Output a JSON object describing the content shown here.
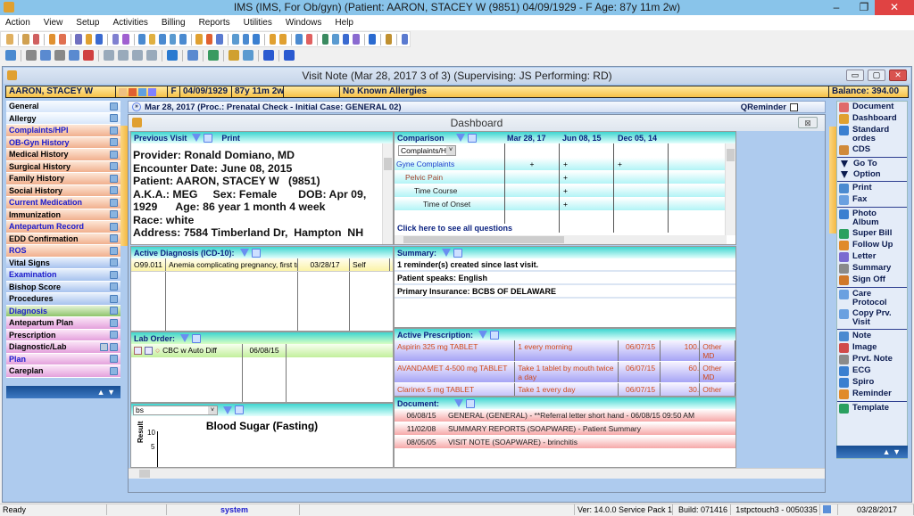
{
  "window": {
    "title": "IMS (IMS, For Ob/gyn)    (Patient: AARON, STACEY W (9851) 04/09/1929 - F Age: 87y 11m 2w)",
    "controls": [
      "minimize",
      "restore",
      "close"
    ]
  },
  "menu": [
    "Action",
    "View",
    "Setup",
    "Activities",
    "Billing",
    "Reports",
    "Utilities",
    "Windows",
    "Help"
  ],
  "visit_note": {
    "title": "Visit Note (Mar 28, 2017   3 of 3) (Supervising: JS Performing: RD)",
    "patient_bar": {
      "name": "AARON, STACEY W",
      "sex": "F",
      "dob": "04/09/1929",
      "age": "87y 11m 2w",
      "blank": "",
      "allergies": "No Known Allergies",
      "balance": "Balance: 394.00"
    },
    "visit_header": "Mar 28, 2017  (Proc.: Prenatal Check - Initial  Case: GENERAL 02)",
    "qreminder_label": "QReminder"
  },
  "sidebar": {
    "items": [
      {
        "label": "General",
        "style": "blue",
        "highlight": false
      },
      {
        "label": "Allergy",
        "style": "blue",
        "highlight": false
      },
      {
        "label": "Complaints/HPI",
        "style": "orange",
        "highlight": true
      },
      {
        "label": "OB-Gyn History",
        "style": "orange",
        "highlight": true
      },
      {
        "label": "Medical History",
        "style": "orange",
        "highlight": false
      },
      {
        "label": "Surgical History",
        "style": "orange",
        "highlight": false
      },
      {
        "label": "Family History",
        "style": "orange",
        "highlight": false
      },
      {
        "label": "Social History",
        "style": "orange",
        "highlight": false
      },
      {
        "label": "Current Medication",
        "style": "orange",
        "highlight": true
      },
      {
        "label": "Immunization",
        "style": "orange",
        "highlight": false
      },
      {
        "label": "Antepartum Record",
        "style": "orange",
        "highlight": true
      },
      {
        "label": "EDD Confirmation",
        "style": "orange",
        "highlight": false
      },
      {
        "label": "ROS",
        "style": "orange",
        "highlight": true
      },
      {
        "label": "Vital Signs",
        "style": "lblue",
        "highlight": false
      },
      {
        "label": "Examination",
        "style": "lblue",
        "highlight": true
      },
      {
        "label": "Bishop Score",
        "style": "lblue",
        "highlight": false
      },
      {
        "label": "Procedures",
        "style": "lblue",
        "highlight": false
      },
      {
        "label": "Diagnosis",
        "style": "green",
        "highlight": true
      },
      {
        "label": "Antepartum Plan",
        "style": "pink",
        "highlight": false
      },
      {
        "label": "Prescription",
        "style": "pink",
        "highlight": false
      },
      {
        "label": "Diagnostic/Lab",
        "style": "pink",
        "highlight": false
      },
      {
        "label": "Plan",
        "style": "pink",
        "highlight": true
      },
      {
        "label": "Careplan",
        "style": "pink",
        "highlight": false
      }
    ],
    "nav": "▲ ▼"
  },
  "dashboard": {
    "title": "Dashboard",
    "close": "⊠",
    "previous_visit": {
      "label": "Previous Visit",
      "print": "Print",
      "lines": [
        "Provider: Ronald Domiano, MD",
        "Encounter Date: June 08, 2015",
        "Patient: AARON, STACEY W   (9851)",
        "A.K.A.: MEG     Sex: Female       DOB: Apr 09,",
        "1929      Age: 86 year 1 month 4 week",
        "Race: white",
        "Address: 7584 Timberland Dr,  Hampton  NH"
      ]
    },
    "comparison": {
      "label": "Comparison",
      "dates": [
        "Mar 28, 17",
        "Jun 08, 15",
        "Dec 05, 14"
      ],
      "select_value": "Complaints/HPI",
      "rows": [
        {
          "label": "Gyne Complaints",
          "marks": [
            "+",
            "+",
            "+"
          ],
          "color": "#1a3ccc",
          "indent": 0
        },
        {
          "label": "Pelvic Pain",
          "marks": [
            "",
            "+",
            ""
          ],
          "color": "#a0402a",
          "indent": 1
        },
        {
          "label": "Time Course",
          "marks": [
            "",
            "+",
            ""
          ],
          "color": "#222",
          "indent": 2
        },
        {
          "label": "Time of Onset",
          "marks": [
            "",
            "+",
            ""
          ],
          "color": "#222",
          "indent": 3
        }
      ],
      "link": "Click here to see all questions"
    },
    "active_diagnosis": {
      "label": "Active Diagnosis (ICD-10):",
      "rows": [
        {
          "code": "O99.011",
          "desc": "Anemia complicating pregnancy, first trim",
          "date": "03/28/17",
          "by": "Self"
        }
      ]
    },
    "summary": {
      "label": "Summary:",
      "lines": [
        "1 reminder(s) created since last visit.",
        "Patient speaks: English",
        "Primary Insurance: BCBS OF DELAWARE"
      ]
    },
    "lab_order": {
      "label": "Lab Order:",
      "rows": [
        {
          "test": "CBC w Auto Diff",
          "date": "06/08/15"
        }
      ]
    },
    "active_prescription": {
      "label": "Active Prescription:",
      "rows": [
        {
          "drug": "Aspirin 325 mg TABLET",
          "sig": "1 every morning",
          "date": "06/07/15",
          "qty": "100.",
          "by": "Other MD"
        },
        {
          "drug": "AVANDAMET 4-500 mg TABLET",
          "sig": "Take 1 tablet by mouth twice a day",
          "date": "06/07/15",
          "qty": "60.",
          "by": "Other MD"
        },
        {
          "drug": "Clarinex 5 mg TABLET",
          "sig": "Take 1 every day",
          "date": "06/07/15",
          "qty": "30.",
          "by": "Other MD"
        }
      ]
    },
    "document": {
      "label": "Document:",
      "rows": [
        {
          "date": "06/08/15",
          "desc": "GENERAL (GENERAL)  - **Referral letter short hand - 06/08/15 09:50 AM"
        },
        {
          "date": "11/02/08",
          "desc": "SUMMARY REPORTS (SOAPWARE)  - Patient Summary"
        },
        {
          "date": "08/05/05",
          "desc": "VISIT NOTE (SOAPWARE)  - brinchitis"
        }
      ]
    },
    "blood_sugar": {
      "select_value": "bs",
      "chart_title": "Blood Sugar (Fasting)",
      "ylabel": "Result",
      "yticks": [
        "10",
        "5"
      ]
    }
  },
  "right_panel": {
    "groups": [
      [
        {
          "label": "Document",
          "icon": "document-icon",
          "color": "#e06a6a"
        },
        {
          "label": "Dashboard",
          "icon": "dashboard-icon",
          "color": "#e0a030"
        },
        {
          "label": "Standard ordes",
          "icon": "standard-orders-icon",
          "color": "#3a7fd0"
        },
        {
          "label": "CDS",
          "icon": "cds-icon",
          "color": "#d08a3a"
        }
      ],
      [
        {
          "label": "Go To",
          "icon": "triangle-down-icon",
          "color": "#0b1b4f"
        },
        {
          "label": "Option",
          "icon": "triangle-down-icon",
          "color": "#0b1b4f"
        }
      ],
      [
        {
          "label": "Print",
          "icon": "printer-icon",
          "color": "#4a8ad0"
        },
        {
          "label": "Fax",
          "icon": "fax-icon",
          "color": "#6aa0e0"
        }
      ],
      [
        {
          "label": "Photo Album",
          "icon": "photo-album-icon",
          "color": "#3a7fd0"
        },
        {
          "label": "Super Bill",
          "icon": "super-bill-icon",
          "color": "#2aa060"
        },
        {
          "label": "Follow Up",
          "icon": "follow-up-icon",
          "color": "#e08a2a"
        },
        {
          "label": "Letter",
          "icon": "letter-icon",
          "color": "#7a6ad0"
        },
        {
          "label": "Summary",
          "icon": "summary-icon",
          "color": "#8a8a8a"
        },
        {
          "label": "Sign Off",
          "icon": "sign-off-icon",
          "color": "#d0782a"
        }
      ],
      [
        {
          "label": "Care Protocol",
          "icon": "care-protocol-icon",
          "color": "#6aa0e0"
        },
        {
          "label": "Copy Prv. Visit",
          "icon": "copy-visit-icon",
          "color": "#6aa0e0"
        }
      ],
      [
        {
          "label": "Note",
          "icon": "note-icon",
          "color": "#4a8ad0"
        },
        {
          "label": "Image",
          "icon": "image-icon",
          "color": "#d04a4a"
        },
        {
          "label": "Prvt. Note",
          "icon": "private-note-icon",
          "color": "#8a8a8a"
        },
        {
          "label": "ECG",
          "icon": "ecg-icon",
          "color": "#3a7fd0"
        },
        {
          "label": "Spiro",
          "icon": "spiro-icon",
          "color": "#3a7fd0"
        },
        {
          "label": "Reminder",
          "icon": "reminder-icon",
          "color": "#e08a2a"
        }
      ],
      [
        {
          "label": "Template",
          "icon": "template-icon",
          "color": "#2aa060"
        }
      ]
    ],
    "nav": "▲ ▼"
  },
  "statusbar": {
    "ready": "Ready",
    "user": "system",
    "version": "Ver: 14.0.0 Service Pack 1",
    "build": "Build: 071416",
    "station": "1stpctouch3 - 0050335",
    "date": "03/28/2017"
  },
  "colors": {
    "titlebar": "#89c4ea",
    "mdi_bg": "#aecbee",
    "panel_header": "#3ed6d0",
    "link_blue": "#1a1acc",
    "rx_text": "#d04a1c"
  }
}
